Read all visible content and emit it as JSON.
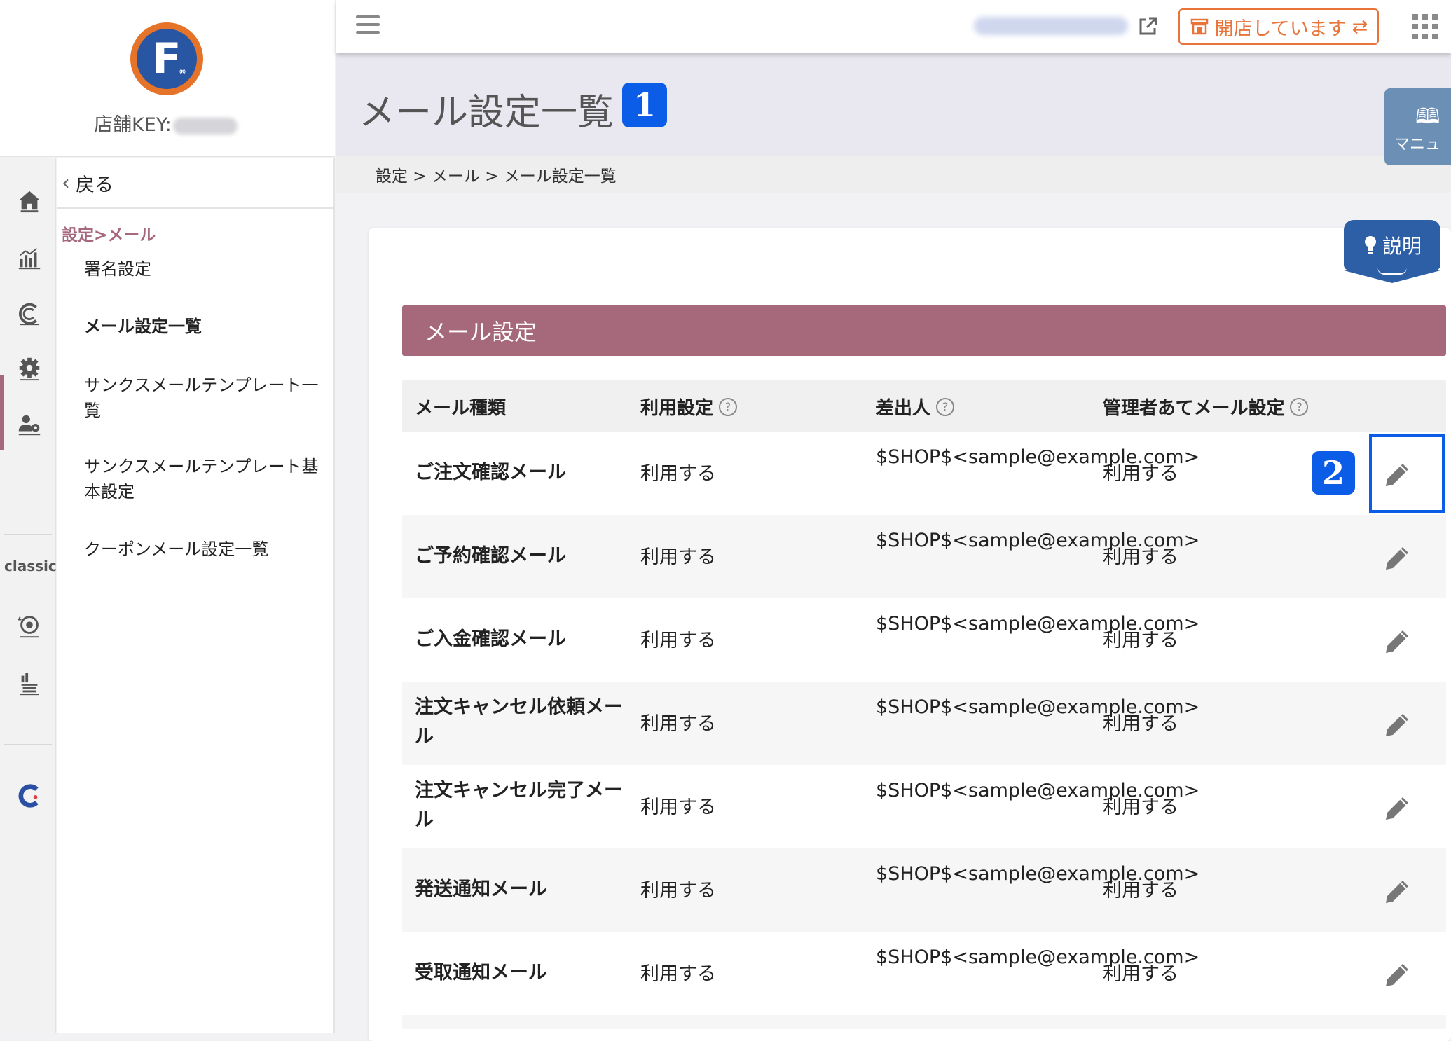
{
  "logo": {
    "letter": "F",
    "registered": "®"
  },
  "shop_key_label": "店舗KEY:",
  "rail": {
    "classic_label": "classic"
  },
  "submenu": {
    "back_label": "戻る",
    "section_title": "設定>メール",
    "items": [
      {
        "label": "署名設定"
      },
      {
        "label": "メール設定一覧"
      },
      {
        "label": "サンクスメールテンプレート一覧"
      },
      {
        "label": "サンクスメールテンプレート基本設定"
      },
      {
        "label": "クーポンメール設定一覧"
      }
    ]
  },
  "topbar": {
    "open_status_label": "開店しています"
  },
  "page": {
    "title": "メール設定一覧",
    "badge_1": "1",
    "badge_2": "2",
    "manual_label": "マニュ",
    "help_label": "説明",
    "breadcrumb": "設定 > メール > メール設定一覧"
  },
  "section_title": "メール設定",
  "table": {
    "headers": [
      "メール種類",
      "利用設定",
      "差出人",
      "管理者あてメール設定"
    ],
    "rows": [
      {
        "kind": "ご注文確認メール",
        "use": "利用する",
        "from": "$SHOP$<sample@example.com>",
        "admin": "利用する"
      },
      {
        "kind": "ご予約確認メール",
        "use": "利用する",
        "from": "$SHOP$<sample@example.com>",
        "admin": "利用する"
      },
      {
        "kind": "ご入金確認メール",
        "use": "利用する",
        "from": "$SHOP$<sample@example.com>",
        "admin": "利用する"
      },
      {
        "kind": "注文キャンセル依頼メール",
        "use": "利用する",
        "from": "$SHOP$<sample@example.com>",
        "admin": "利用する"
      },
      {
        "kind": "注文キャンセル完了メール",
        "use": "利用する",
        "from": "$SHOP$<sample@example.com>",
        "admin": "利用する"
      },
      {
        "kind": "発送通知メール",
        "use": "利用する",
        "from": "$SHOP$<sample@example.com>",
        "admin": "利用する"
      },
      {
        "kind": "受取通知メール",
        "use": "利用する",
        "from": "$SHOP$<sample@example.com>",
        "admin": "利用する"
      }
    ]
  },
  "colors": {
    "accent": "#a6697c",
    "highlight": "#0b5ce6",
    "open_status": "#e8743b",
    "help": "#2d5fa6"
  },
  "icons": [
    "home-icon",
    "analytics-icon",
    "coupon-c-icon",
    "settings-gear-icon",
    "user-settings-icon",
    "classic-settings-icon",
    "classic-report-icon",
    "brand-c-icon",
    "external-link-icon",
    "apps-grid-icon",
    "pencil-icon",
    "book-icon",
    "lightbulb-icon"
  ]
}
